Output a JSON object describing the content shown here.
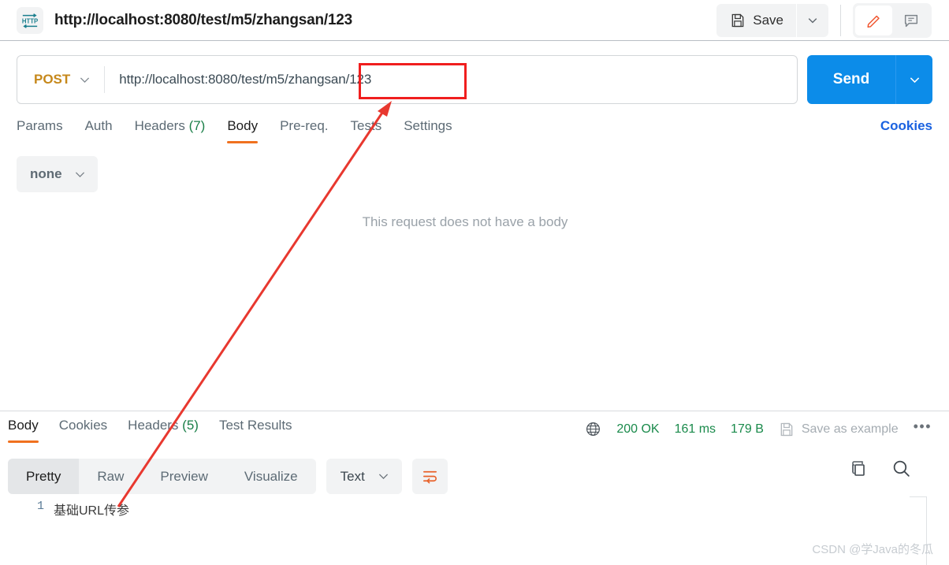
{
  "header": {
    "protocol_badge": "HTTP",
    "request_title": "http://localhost:8080/test/m5/zhangsan/123",
    "save_label": "Save",
    "save_caret_icon": "chevron-down-icon",
    "edit_icon": "pencil-icon",
    "comment_icon": "comment-icon"
  },
  "url_bar": {
    "method": "POST",
    "method_caret_icon": "chevron-down-icon",
    "url": "http://localhost:8080/test/m5/zhangsan/123",
    "send_label": "Send",
    "send_caret_icon": "chevron-down-icon"
  },
  "request_tabs": {
    "items": [
      {
        "label": "Params",
        "count": "",
        "active": false
      },
      {
        "label": "Auth",
        "count": "",
        "active": false
      },
      {
        "label": "Headers",
        "count": "(7)",
        "active": false
      },
      {
        "label": "Body",
        "count": "",
        "active": true
      },
      {
        "label": "Pre-req.",
        "count": "",
        "active": false
      },
      {
        "label": "Tests",
        "count": "",
        "active": false
      },
      {
        "label": "Settings",
        "count": "",
        "active": false
      }
    ],
    "cookies_link": "Cookies"
  },
  "body_panel": {
    "body_type": "none",
    "body_type_caret_icon": "chevron-down-icon",
    "empty_message": "This request does not have a body"
  },
  "response": {
    "tabs": [
      {
        "label": "Body",
        "count": "",
        "active": true
      },
      {
        "label": "Cookies",
        "count": "",
        "active": false
      },
      {
        "label": "Headers",
        "count": "(5)",
        "active": false
      },
      {
        "label": "Test Results",
        "count": "",
        "active": false
      }
    ],
    "network_icon": "globe-icon",
    "status": "200 OK",
    "time": "161 ms",
    "size": "179 B",
    "save_example_icon": "floppy-disk-icon",
    "save_example_label": "Save as example",
    "more_label": "•••",
    "view_modes": [
      {
        "label": "Pretty",
        "active": true
      },
      {
        "label": "Raw",
        "active": false
      },
      {
        "label": "Preview",
        "active": false
      },
      {
        "label": "Visualize",
        "active": false
      }
    ],
    "format": "Text",
    "format_caret_icon": "chevron-down-icon",
    "wrap_icon": "word-wrap-icon",
    "copy_icon": "copy-icon",
    "search_icon": "search-icon",
    "body_lines": [
      {
        "no": "1",
        "text": "基础URL传参"
      }
    ]
  },
  "annotations": {
    "highlight_rect_color": "#f01e1e",
    "arrow_color": "#e8382f"
  },
  "watermark": "CSDN @学Java的冬瓜",
  "colors": {
    "accent_orange": "#f0711f",
    "send_blue": "#0c8ce9",
    "method_amber": "#c6881b",
    "success_green": "#1a8a4b",
    "link_blue": "#1a62e0"
  }
}
